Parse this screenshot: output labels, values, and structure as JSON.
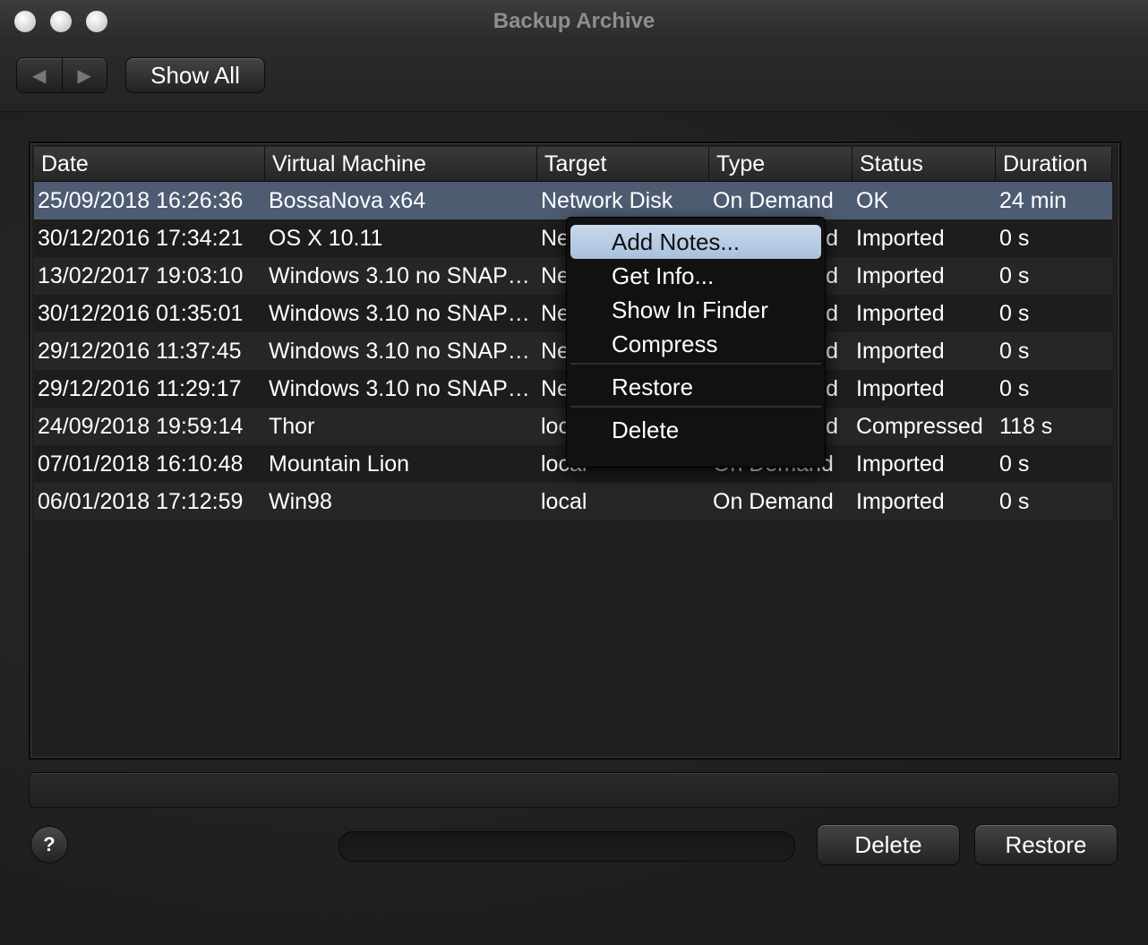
{
  "window": {
    "title": "Backup Archive"
  },
  "toolbar": {
    "back_glyph": "◀",
    "forward_glyph": "▶",
    "show_all_label": "Show All"
  },
  "table": {
    "columns": [
      "Date",
      "Virtual Machine",
      "Target",
      "Type",
      "Status",
      "Duration"
    ],
    "rows": [
      [
        "25/09/2018 16:26:36",
        "BossaNova x64",
        "Network Disk",
        "On Demand",
        "OK",
        "24 min"
      ],
      [
        "30/12/2016 17:34:21",
        "OS X 10.11",
        "Ne",
        "d",
        "Imported",
        "0 s"
      ],
      [
        "13/02/2017 19:03:10",
        "Windows 3.10 no SNAP…",
        "Ne",
        "d",
        "Imported",
        "0 s"
      ],
      [
        "30/12/2016 01:35:01",
        "Windows 3.10 no SNAP…",
        "Ne",
        "d",
        "Imported",
        "0 s"
      ],
      [
        "29/12/2016 11:37:45",
        "Windows 3.10 no SNAP…",
        "Ne",
        "d",
        "Imported",
        "0 s"
      ],
      [
        "29/12/2016 11:29:17",
        "Windows 3.10 no SNAP…",
        "Ne",
        "d",
        "Imported",
        "0 s"
      ],
      [
        "24/09/2018 19:59:14",
        "Thor",
        "loc",
        "d",
        "Compressed",
        "118 s"
      ],
      [
        "07/01/2018 16:10:48",
        "Mountain Lion",
        "local",
        "On Demand",
        "Imported",
        "0 s"
      ],
      [
        "06/01/2018 17:12:59",
        "Win98",
        "local",
        "On Demand",
        "Imported",
        "0 s"
      ]
    ],
    "selected_row": 0
  },
  "context_menu": {
    "items": [
      "Add Notes...",
      "Get Info...",
      "Show In Finder",
      "Compress",
      "Restore",
      "Delete"
    ]
  },
  "footer": {
    "help_label": "?",
    "delete_label": "Delete",
    "restore_label": "Restore"
  }
}
